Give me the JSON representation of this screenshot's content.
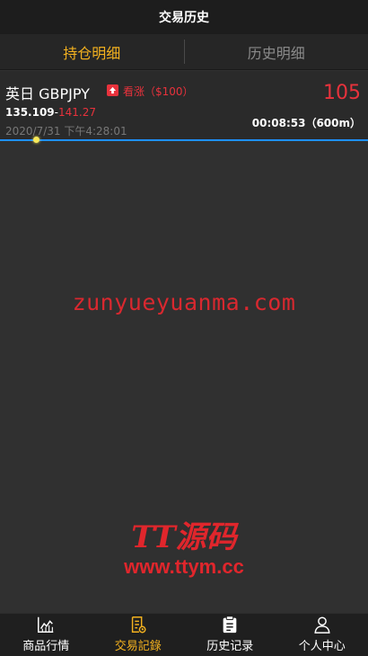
{
  "header": {
    "title": "交易历史"
  },
  "tabs": [
    {
      "label": "持仓明细",
      "active": true
    },
    {
      "label": "历史明细",
      "active": false
    }
  ],
  "position": {
    "name": "英日 GBPJPY",
    "direction_icon": "arrow-up-icon",
    "direction_label": "看涨（$100）",
    "amount": "105",
    "open_price": "135.109",
    "separator": "-",
    "current_price": "141.27",
    "timer": "00:08:53（600m）",
    "date": "2020/7/31 下午4:28:01",
    "progress_fraction": 0.1
  },
  "watermark": {
    "text": "zunyueyuanma.com"
  },
  "logo": {
    "main": "TT源码",
    "url": "www.ttym.cc"
  },
  "tabbar": [
    {
      "label": "商品行情",
      "icon": "chart-icon",
      "active": false
    },
    {
      "label": "交易記錄",
      "icon": "document-icon",
      "active": true
    },
    {
      "label": "历史记录",
      "icon": "clipboard-icon",
      "active": false
    },
    {
      "label": "个人中心",
      "icon": "user-icon",
      "active": false
    }
  ],
  "colors": {
    "accent": "#f3b11f",
    "rise": "#e8323c",
    "progress": "#1e90ff",
    "background": "#303030"
  }
}
